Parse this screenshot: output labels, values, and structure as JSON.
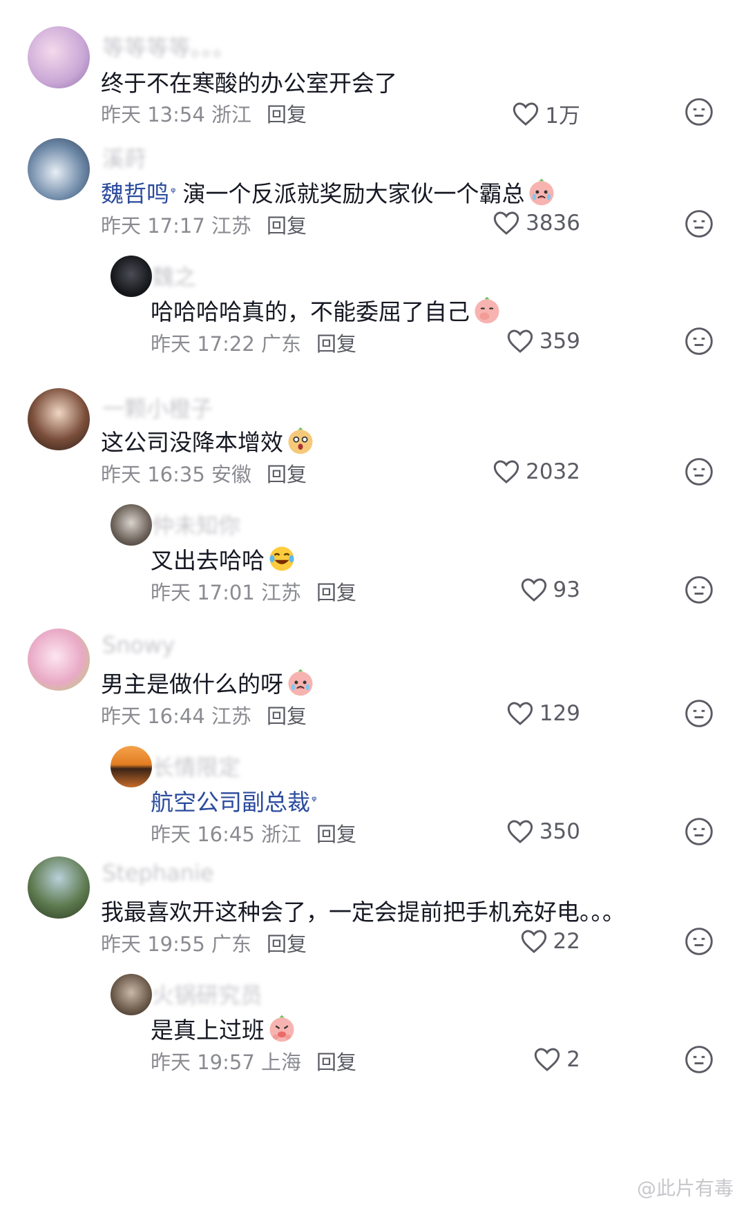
{
  "comments": [
    {
      "user": "等等等等。。。",
      "text": "终于不在寒酸的办公室开会了",
      "time": "昨天 13:54 浙江",
      "reply": "回复",
      "likes": "1万"
    },
    {
      "user": "溪莳",
      "mention": "魏哲鸣",
      "text": "演一个反派就奖励大家伙一个霸总",
      "time": "昨天 17:17 江苏",
      "reply": "回复",
      "likes": "3836"
    },
    {
      "user": "魏之",
      "text": "哈哈哈哈真的，不能委屈了自己",
      "time": "昨天 17:22 广东",
      "reply": "回复",
      "likes": "359"
    },
    {
      "user": "一颗小橙子",
      "text": "这公司没降本增效",
      "time": "昨天 16:35 安徽",
      "reply": "回复",
      "likes": "2032"
    },
    {
      "user": "仲未知你",
      "text": "叉出去哈哈",
      "time": "昨天 17:01 江苏",
      "reply": "回复",
      "likes": "93"
    },
    {
      "user": "Snowy",
      "text": "男主是做什么的呀",
      "time": "昨天 16:44 江苏",
      "reply": "回复",
      "likes": "129"
    },
    {
      "user": "长情限定",
      "mention": "航空公司副总裁",
      "text": "",
      "time": "昨天 16:45 浙江",
      "reply": "回复",
      "likes": "350"
    },
    {
      "user": "Stephanie",
      "text": "我最喜欢开这种会了，一定会提前把手机充好电。。。",
      "time": "昨天 19:55 广东",
      "reply": "回复",
      "likes": "22"
    },
    {
      "user": "火锅研究员",
      "text": "是真上过班",
      "time": "昨天 19:57 上海",
      "reply": "回复",
      "likes": "2"
    }
  ],
  "watermark": "@此片有毒",
  "colors": {
    "mention": "#2a4a9c",
    "meta": "#8a8b91",
    "text": "#161823"
  }
}
